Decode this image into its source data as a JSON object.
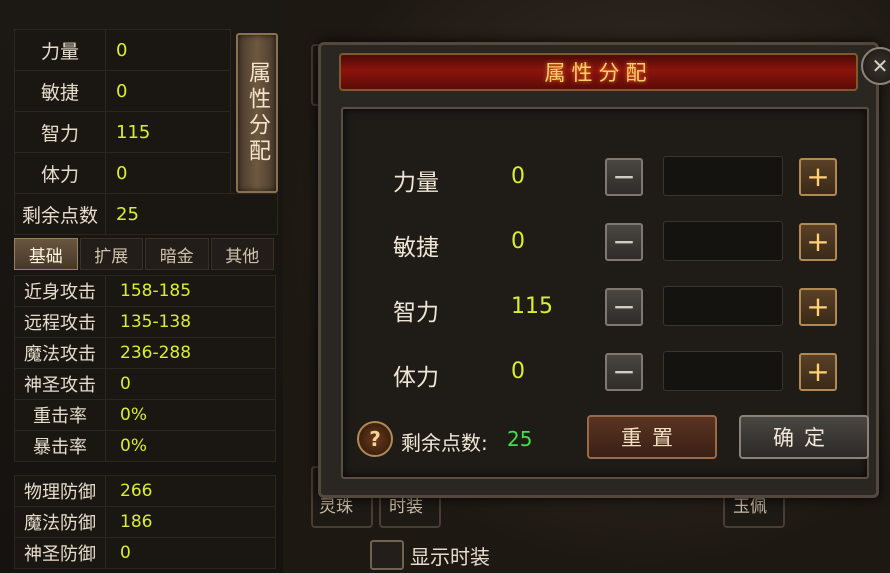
{
  "left_panel": {
    "attributes": [
      {
        "label": "力量",
        "value": "0"
      },
      {
        "label": "敏捷",
        "value": "0"
      },
      {
        "label": "智力",
        "value": "115"
      },
      {
        "label": "体力",
        "value": "0"
      }
    ],
    "allocate_button": "属性分配",
    "remaining_label": "剩余点数",
    "remaining_value": "25",
    "tabs": [
      "基础",
      "扩展",
      "暗金",
      "其他"
    ],
    "active_tab": "基础",
    "attack_stats": [
      {
        "label": "近身攻击",
        "value": "158-185"
      },
      {
        "label": "远程攻击",
        "value": "135-138"
      },
      {
        "label": "魔法攻击",
        "value": "236-288"
      },
      {
        "label": "神圣攻击",
        "value": "0"
      },
      {
        "label": "重击率",
        "value": "0%"
      },
      {
        "label": "暴击率",
        "value": "0%"
      }
    ],
    "defense_stats": [
      {
        "label": "物理防御",
        "value": "266"
      },
      {
        "label": "魔法防御",
        "value": "186"
      },
      {
        "label": "神圣防御",
        "value": "0"
      }
    ]
  },
  "background": {
    "slot_labels": [
      "灵珠",
      "时装",
      "玉佩"
    ],
    "show_fashion_label": "显示时装"
  },
  "dialog": {
    "title": "属性分配",
    "close_icon": "close-icon",
    "rows": [
      {
        "label": "力量",
        "value": "0",
        "minus": "−",
        "plus": "+"
      },
      {
        "label": "敏捷",
        "value": "0",
        "minus": "−",
        "plus": "+"
      },
      {
        "label": "智力",
        "value": "115",
        "minus": "−",
        "plus": "+"
      },
      {
        "label": "体力",
        "value": "0",
        "minus": "−",
        "plus": "+"
      }
    ],
    "help_icon": "?",
    "remaining_label": "剩余点数:",
    "remaining_value": "25",
    "reset_button": "重置",
    "confirm_button": "确定"
  },
  "colors": {
    "value_yellow": "#d9ef2c",
    "remaining_green": "#3fe04a",
    "title_red": "#8c140d",
    "title_gold": "#ffd06a"
  }
}
